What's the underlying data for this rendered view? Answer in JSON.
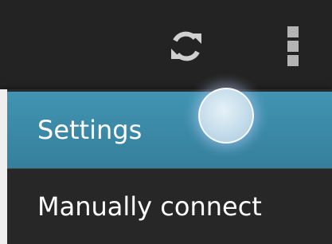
{
  "action_bar": {
    "refresh_icon": "refresh-icon",
    "overflow_icon": "overflow-menu-icon",
    "background": "#232323",
    "icon_color": "#cfcfcf"
  },
  "menu": {
    "items": [
      {
        "label": "Settings",
        "highlighted": true
      },
      {
        "label": "Manually connect",
        "highlighted": false
      }
    ],
    "highlight_color": "#3f8daa"
  }
}
